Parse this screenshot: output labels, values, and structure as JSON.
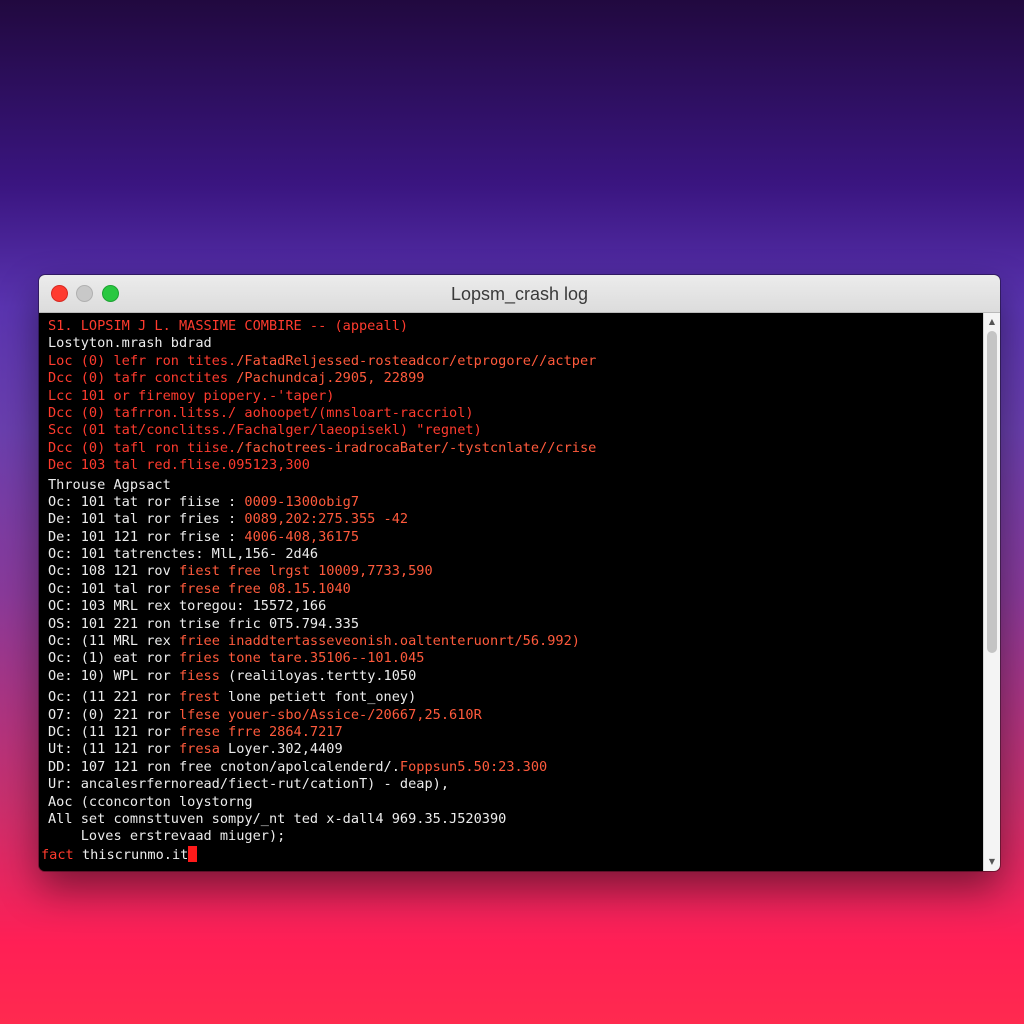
{
  "window": {
    "title": "Lopsm_crash log"
  },
  "terminal": {
    "lines": [
      [
        {
          "t": "S1. LOPSIM J L. MASSIME COMBIRE -- (appeall)",
          "c": "red"
        }
      ],
      [
        {
          "t": "Lostyton.mrash bdrad",
          "c": "white"
        }
      ],
      [
        {
          "t": "Loc (0) lefr ron tites.",
          "c": "red"
        },
        {
          "t": "/FatadReljessed-rosteadcor/etprogore//actper",
          "c": "orange"
        }
      ],
      [
        {
          "t": "Dcc (0) tafr conctites ",
          "c": "red"
        },
        {
          "t": "/Pachundcaj.2905, 22899",
          "c": "orange"
        }
      ],
      [
        {
          "t": "Lcc 101 or firemoy piopery.-'taper)",
          "c": "red"
        }
      ],
      [
        {
          "t": "Dcc (0) tafrron.litss./ aohoopet/(mnsloart-raccriol)",
          "c": "red"
        }
      ],
      [
        {
          "t": "Scc (01 tat/conclitss./Fachalger/laeopisekl) \"regnet)",
          "c": "red"
        }
      ],
      [
        {
          "t": "Dcc (0) tafl ron tiise.",
          "c": "red"
        },
        {
          "t": "/fachotrees-iradrocaBater/-tystcnlate//crise",
          "c": "orange"
        }
      ],
      [
        {
          "t": "Dec 103 tal red.flise.095123,300",
          "c": "red"
        }
      ],
      [
        {
          "t": "Throuse Agpsact",
          "c": "white"
        }
      ],
      [
        {
          "t": "Oc: 101 tat ror fiise : ",
          "c": "white"
        },
        {
          "t": "0009-1300obig7",
          "c": "orange"
        }
      ],
      [
        {
          "t": "De: 101 tal ror fries : ",
          "c": "white"
        },
        {
          "t": "0089,202:275.355 -42",
          "c": "orange"
        }
      ],
      [
        {
          "t": "De: 101 121 ror frise : ",
          "c": "white"
        },
        {
          "t": "4006-408,36175",
          "c": "orange"
        }
      ],
      [
        {
          "t": "Oc: 101 tatrenctes: MlL,156- 2d46",
          "c": "white"
        }
      ],
      [
        {
          "t": "Oc: 108 121 rov ",
          "c": "white"
        },
        {
          "t": "fiest free lrgst 10009,7733,590",
          "c": "orange"
        }
      ],
      [
        {
          "t": "Oc: 101 tal ror ",
          "c": "white"
        },
        {
          "t": "frese free 08.15.1040",
          "c": "orange"
        }
      ],
      [
        {
          "t": "OC: 103 MRL rex toregou: 15572,166",
          "c": "white"
        }
      ],
      [
        {
          "t": "OS: 101 221 ron trise fric 0T5.794.335",
          "c": "white"
        }
      ],
      [
        {
          "t": "Oc: (11 MRL rex ",
          "c": "white"
        },
        {
          "t": "friee inaddtertasseveonish.oaltenteruonrt/56.992)",
          "c": "orange"
        }
      ],
      [
        {
          "t": "Oc: (1) eat ror ",
          "c": "white"
        },
        {
          "t": "fries tone tare.35106--101.045",
          "c": "orange"
        }
      ],
      [
        {
          "t": "Oe: 10) WPL ror ",
          "c": "white"
        },
        {
          "t": "fiess",
          "c": "orange"
        },
        {
          "t": " (realiloyas.tertty.1050",
          "c": "white"
        }
      ],
      [
        {
          "t": "Oc: (11 221 ror ",
          "c": "white"
        },
        {
          "t": "frest",
          "c": "orange"
        },
        {
          "t": " lone petiett font_oney)",
          "c": "white"
        }
      ],
      [
        {
          "t": "O7: (0) 221 ror ",
          "c": "white"
        },
        {
          "t": "lfese youer-sbo/Assice-/20667,25.610R",
          "c": "orange"
        }
      ],
      [
        {
          "t": "DC: (11 121 ror ",
          "c": "white"
        },
        {
          "t": "frese frre 2864.7217",
          "c": "orange"
        }
      ],
      [
        {
          "t": "Ut: (11 121 ror ",
          "c": "white"
        },
        {
          "t": "fresa",
          "c": "orange"
        },
        {
          "t": " Loyer.302,4409",
          "c": "white"
        }
      ],
      [
        {
          "t": "DD: 107 121 ron free cnoton/apolcalenderd/.",
          "c": "white"
        },
        {
          "t": "Foppsun5.50:23.300",
          "c": "orange"
        }
      ],
      [
        {
          "t": "Ur: ancalesrfernoread/fiect-rut/cationT) - deap),",
          "c": "white"
        }
      ],
      [
        {
          "t": "Aoc (cconcorton loystorng",
          "c": "white"
        }
      ],
      [
        {
          "t": "All set comnsttuven sompy/_nt ted x-dall4 969.35.J520390",
          "c": "white"
        }
      ],
      [
        {
          "t": "    Loves erstrevaad miuger);",
          "c": "white"
        }
      ]
    ],
    "prompt": {
      "prefix": "fact",
      "input": "thiscrunmo.it"
    }
  },
  "colors": {
    "red": "#ff3b2e",
    "orange": "#ff5a3c",
    "white": "#ececec",
    "cursor": "#ff1a1a"
  },
  "scrollbar": {
    "up_icon": "▲",
    "down_icon": "▼"
  }
}
